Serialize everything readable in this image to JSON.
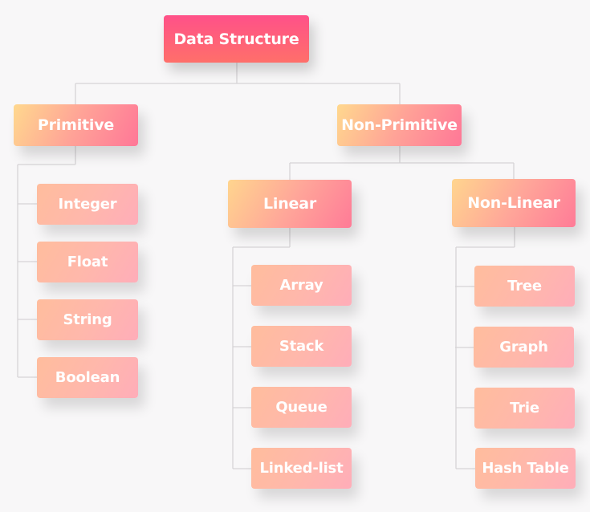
{
  "diagram": {
    "type": "hierarchy-tree",
    "colors": {
      "background": "#f8f7f8",
      "connector": "#d6d4d6",
      "root_gradient": [
        "#ff5189",
        "#ff6f6a"
      ],
      "category_gradient": [
        "#ffd88e",
        "#ffa397",
        "#ff7797"
      ],
      "leaf_gradient": [
        "#ffbd9d",
        "#ffb7ac",
        "#ffadb9"
      ],
      "text": "#ffffff"
    },
    "root": {
      "label": "Data Structure"
    },
    "primitive": {
      "label": "Primitive",
      "children": [
        "Integer",
        "Float",
        "String",
        "Boolean"
      ]
    },
    "non_primitive": {
      "label": "Non-Primitive",
      "linear": {
        "label": "Linear",
        "children": [
          "Array",
          "Stack",
          "Queue",
          "Linked-list"
        ]
      },
      "non_linear": {
        "label": "Non-Linear",
        "children": [
          "Tree",
          "Graph",
          "Trie",
          "Hash Table"
        ]
      }
    }
  }
}
